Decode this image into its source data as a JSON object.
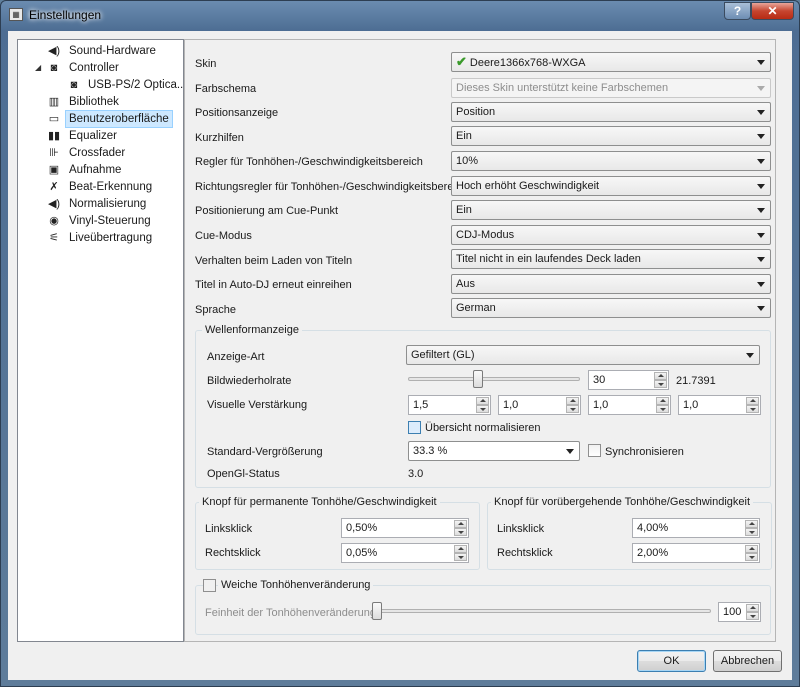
{
  "window": {
    "title": "Einstellungen",
    "help_label": "?",
    "close_label": "✕"
  },
  "sidebar": {
    "items": [
      {
        "label": "Sound-Hardware",
        "icon": "speaker-icon"
      },
      {
        "label": "Controller",
        "icon": "controller-icon"
      },
      {
        "label": "USB-PS/2 Optica...",
        "icon": "controller-icon"
      },
      {
        "label": "Bibliothek",
        "icon": "library-icon"
      },
      {
        "label": "Benutzeroberfläche",
        "icon": "monitor-icon"
      },
      {
        "label": "Equalizer",
        "icon": "equalizer-icon"
      },
      {
        "label": "Crossfader",
        "icon": "crossfader-icon"
      },
      {
        "label": "Aufnahme",
        "icon": "recording-icon"
      },
      {
        "label": "Beat-Erkennung",
        "icon": "beat-detection-icon"
      },
      {
        "label": "Normalisierung",
        "icon": "normalization-icon"
      },
      {
        "label": "Vinyl-Steuerung",
        "icon": "vinyl-icon"
      },
      {
        "label": "Liveübertragung",
        "icon": "broadcast-icon"
      }
    ],
    "selected": "Benutzeroberfläche"
  },
  "settings": {
    "skin": {
      "label": "Skin",
      "value": "Deere1366x768-WXGA"
    },
    "farbschema": {
      "label": "Farbschema",
      "value": "Dieses Skin unterstützt keine Farbschemen"
    },
    "positionsanzeige": {
      "label": "Positionsanzeige",
      "value": "Position"
    },
    "kurzhilfen": {
      "label": "Kurzhilfen",
      "value": "Ein"
    },
    "regler_bereich": {
      "label": "Regler für Tonhöhen-/Geschwindigkeitsbereich",
      "value": "10%"
    },
    "richtungsregler": {
      "label": "Richtungsregler für Tonhöhen-/Geschwindigkeitsbereich",
      "value": "Hoch erhöht Geschwindigkeit"
    },
    "cue_punkt": {
      "label": "Positionierung am Cue-Punkt",
      "value": "Ein"
    },
    "cue_modus": {
      "label": "Cue-Modus",
      "value": "CDJ-Modus"
    },
    "laden": {
      "label": "Verhalten beim Laden von Titeln",
      "value": "Titel nicht in ein laufendes Deck laden"
    },
    "auto_dj": {
      "label": "Titel in Auto-DJ erneut einreihen",
      "value": "Aus"
    },
    "sprache": {
      "label": "Sprache",
      "value": "German"
    }
  },
  "waveform": {
    "title": "Wellenformanzeige",
    "anzeige_art": {
      "label": "Anzeige-Art",
      "value": "Gefiltert (GL)"
    },
    "bildwiederholrate": {
      "label": "Bildwiederholrate",
      "value": "30",
      "readout": "21.7391",
      "slider_fraction": 0.4
    },
    "verstaerkung": {
      "label": "Visuelle Verstärkung",
      "values": [
        "1,5",
        "1,0",
        "1,0",
        "1,0"
      ]
    },
    "normalisieren": {
      "label": "Übersicht normalisieren",
      "checked": false
    },
    "vergroesserung": {
      "label": "Standard-Vergrößerung",
      "value": "33.3 %"
    },
    "synchronisieren": {
      "label": "Synchronisieren",
      "checked": false
    },
    "opengl": {
      "label": "OpenGl-Status",
      "value": "3.0"
    }
  },
  "knopf_permanent": {
    "title": "Knopf für permanente Tonhöhe/Geschwindigkeit",
    "linksklick": {
      "label": "Linksklick",
      "value": "0,50%"
    },
    "rechtsklick": {
      "label": "Rechtsklick",
      "value": "0,05%"
    }
  },
  "knopf_temporaer": {
    "title": "Knopf für vorübergehende Tonhöhe/Geschwindigkeit",
    "linksklick": {
      "label": "Linksklick",
      "value": "4,00%"
    },
    "rechtsklick": {
      "label": "Rechtsklick",
      "value": "2,00%"
    }
  },
  "weiche": {
    "title": "Weiche Tonhöhenveränderung",
    "checked": false,
    "feinheit": {
      "label": "Feinheit der Tonhöhenveränderung",
      "value": "100",
      "slider_fraction": 0.0
    }
  },
  "buttons": {
    "ok": "OK",
    "cancel": "Abbrechen"
  },
  "colors": {
    "selection": "#cde8ff",
    "accent": "#3c7fb1",
    "checkmark": "#3a9a2b"
  }
}
